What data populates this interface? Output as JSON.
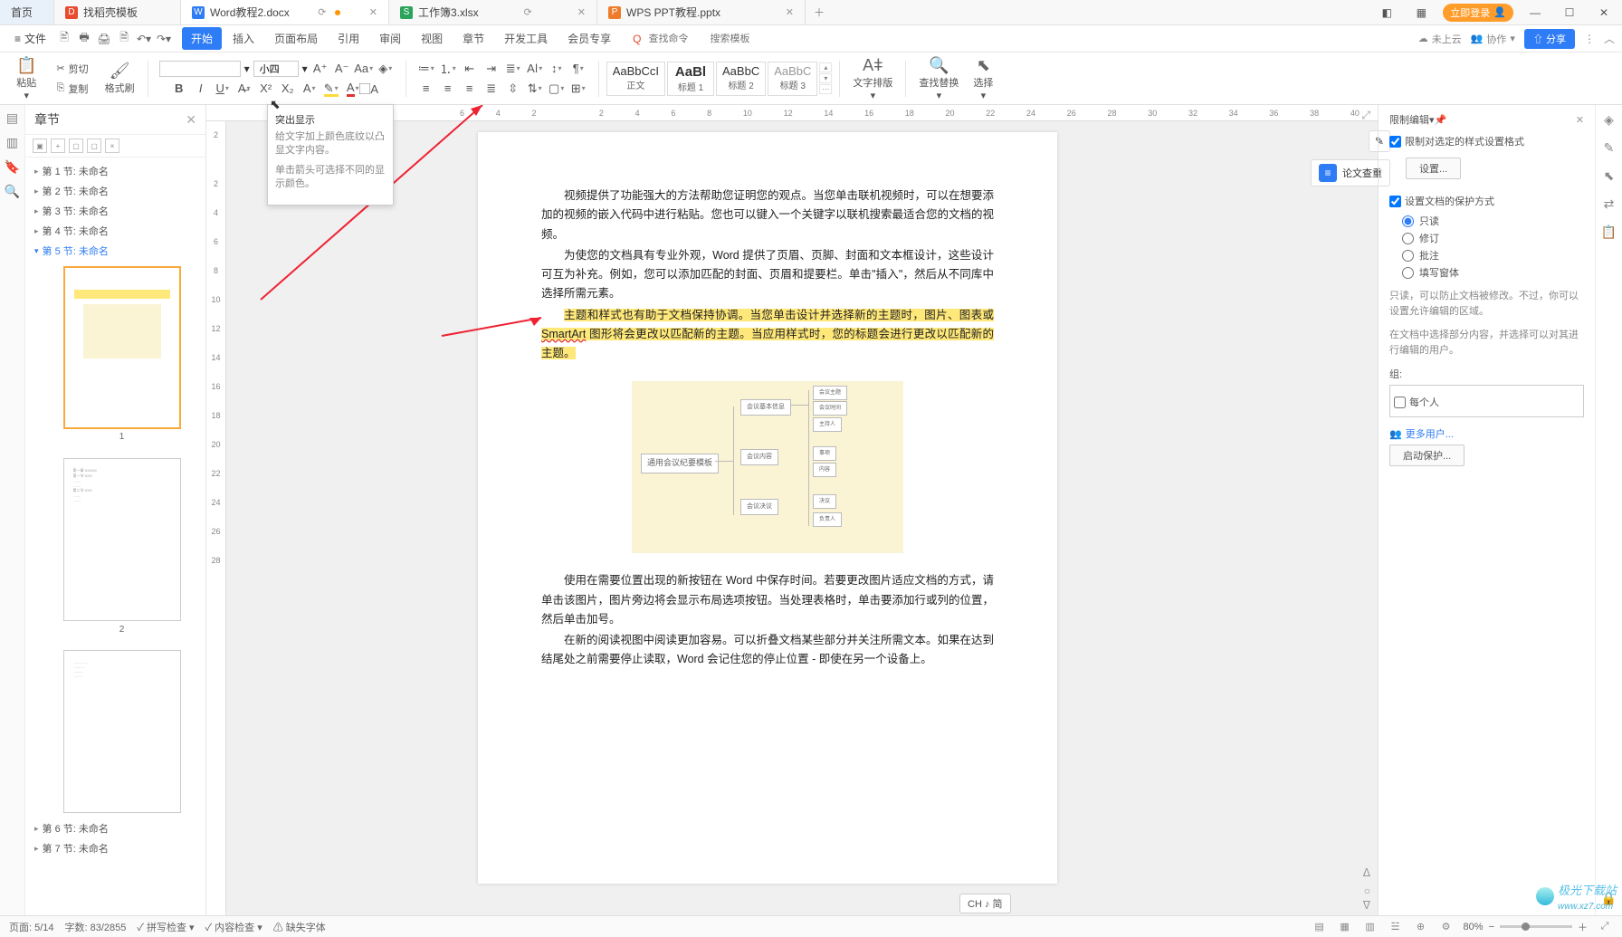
{
  "tabs": {
    "home": "首页",
    "t1": "找稻壳模板",
    "t2": "Word教程2.docx",
    "t3": "工作簿3.xlsx",
    "t4": "WPS PPT教程.pptx"
  },
  "top_right": {
    "login": "立即登录"
  },
  "menu": {
    "file": "文件",
    "items": [
      "开始",
      "插入",
      "页面布局",
      "引用",
      "审阅",
      "视图",
      "章节",
      "开发工具",
      "会员专享"
    ],
    "search_ph": "查找命令",
    "search2_ph": "搜索模板",
    "cloud": "未上云",
    "collab": "协作",
    "share": "分享"
  },
  "ribbon": {
    "paste": "粘贴",
    "cut": "剪切",
    "copy": "复制",
    "fmt": "格式刷",
    "font_name": "",
    "font_size": "小四",
    "styles": [
      {
        "prev": "AaBbCcI",
        "nm": "正文"
      },
      {
        "prev": "AaBl",
        "nm": "标题 1"
      },
      {
        "prev": "AaBbC",
        "nm": "标题 2"
      },
      {
        "prev": "AaBbC",
        "nm": "标题 3"
      }
    ],
    "textdir": "文字排版",
    "findrep": "查找替换",
    "select": "选择"
  },
  "outline": {
    "title": "章节",
    "sections": [
      "第 1 节: 未命名",
      "第 2 节: 未命名",
      "第 3 节: 未命名",
      "第 4 节: 未命名",
      "第 5 节: 未命名",
      "第 6 节: 未命名",
      "第 7 节: 未命名"
    ],
    "pages": [
      "1",
      "2"
    ]
  },
  "tooltip": {
    "title": "突出显示",
    "line1": "给文字加上颜色底纹以凸显文字内容。",
    "line2": "单击箭头可选择不同的显示颜色。"
  },
  "doc": {
    "p1": "视频提供了功能强大的方法帮助您证明您的观点。当您单击联机视频时，可以在想要添加的视频的嵌入代码中进行粘贴。您也可以键入一个关键字以联机搜索最适合您的文档的视频。",
    "p2": "为使您的文档具有专业外观，Word 提供了页眉、页脚、封面和文本框设计，这些设计可互为补充。例如，您可以添加匹配的封面、页眉和提要栏。单击\"插入\"，然后从不同库中选择所需元素。",
    "p3a": "主题和样式也有助于文档保持协调。当您单击设计并选择新的主题时，图片、图表或 ",
    "p3b": "SmartArt",
    "p3c": " 图形将会更改以匹配新的主题。当应用样式时，您的标题会进行更改以匹配新的主题。",
    "dia_center": "通用会议纪要模板",
    "p4": "使用在需要位置出现的新按钮在 Word 中保存时间。若要更改图片适应文档的方式，请单击该图片，图片旁边将会显示布局选项按钮。当处理表格时，单击要添加行或列的位置，然后单击加号。",
    "p5": "在新的阅读视图中阅读更加容易。可以折叠文档某些部分并关注所需文本。如果在达到结尾处之前需要停止读取，Word 会记住您的停止位置 - 即使在另一个设备上。"
  },
  "rpanel": {
    "title": "限制编辑",
    "chk1": "限制对选定的样式设置格式",
    "setbtn": "设置...",
    "chk2": "设置文档的保护方式",
    "radios": [
      "只读",
      "修订",
      "批注",
      "填写窗体"
    ],
    "note1": "只读，可以防止文档被修改。不过，你可以设置允许编辑的区域。",
    "note2": "在文档中选择部分内容，并选择可以对其进行编辑的用户。",
    "group": "组:",
    "every": "每个人",
    "more": "更多用户...",
    "start": "启动保护..."
  },
  "float": {
    "check": "论文查重"
  },
  "status": {
    "page": "页面: 5/14",
    "words": "字数: 83/2855",
    "spell": "拼写检查",
    "content": "内容检查",
    "font": "缺失字体",
    "zoom": "80%"
  },
  "ruler_h": [
    "6",
    "4",
    "2",
    "",
    "2",
    "4",
    "6",
    "8",
    "10",
    "12",
    "14",
    "16",
    "18",
    "20",
    "22",
    "24",
    "26",
    "28",
    "30",
    "32",
    "34",
    "36",
    "38",
    "40"
  ],
  "ruler_v": [
    "2",
    "",
    "2",
    "4",
    "6",
    "8",
    "10",
    "12",
    "14",
    "16",
    "18",
    "20",
    "22",
    "24",
    "26",
    "28"
  ],
  "lang": "CH ♪ 简",
  "watermark": "极光下载站",
  "watermark_url": "www.xz7.com"
}
